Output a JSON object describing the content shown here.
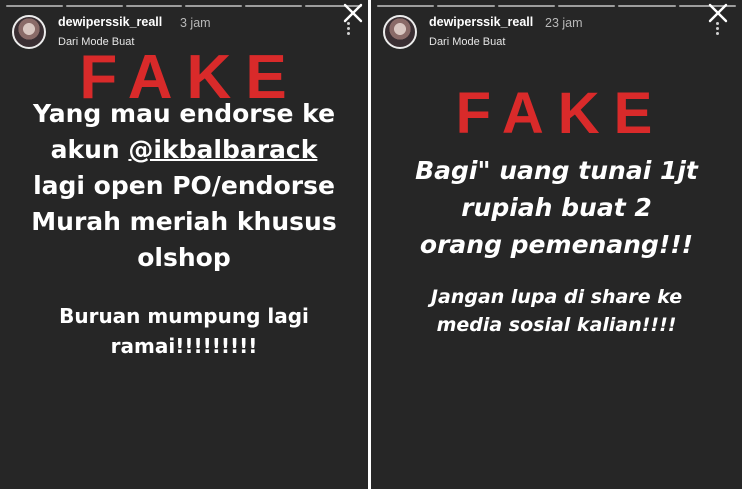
{
  "left_story": {
    "username": "dewiperssik_reall",
    "time": "3 jam",
    "subtitle": "Dari Mode Buat",
    "fake_label": "FAKE",
    "main_lines_1": "Yang mau endorse ke",
    "main_lines_2_prefix": "akun ",
    "main_lines_2_mention": "@ikbalbarack",
    "main_lines_3": "lagi open PO/endorse",
    "main_lines_4": "Murah meriah khusus",
    "main_lines_5": "olshop",
    "secondary_1": "Buruan mumpung lagi",
    "secondary_2": "ramai!!!!!!!!!"
  },
  "right_story": {
    "username": "dewiperssik_reall",
    "time": "23 jam",
    "subtitle": "Dari Mode Buat",
    "fake_label": "FAKE",
    "main_1": "Bagi\" uang tunai 1jt",
    "main_2": "rupiah buat 2",
    "main_3": "orang pemenang!!!",
    "secondary_1": "Jangan lupa di share ke",
    "secondary_2": "media sosial kalian!!!!"
  },
  "colors": {
    "background": "#262626",
    "fake_red": "#d92a2a",
    "text": "#ffffff"
  },
  "icons": [
    "close-icon",
    "more-options-icon",
    "avatar"
  ]
}
